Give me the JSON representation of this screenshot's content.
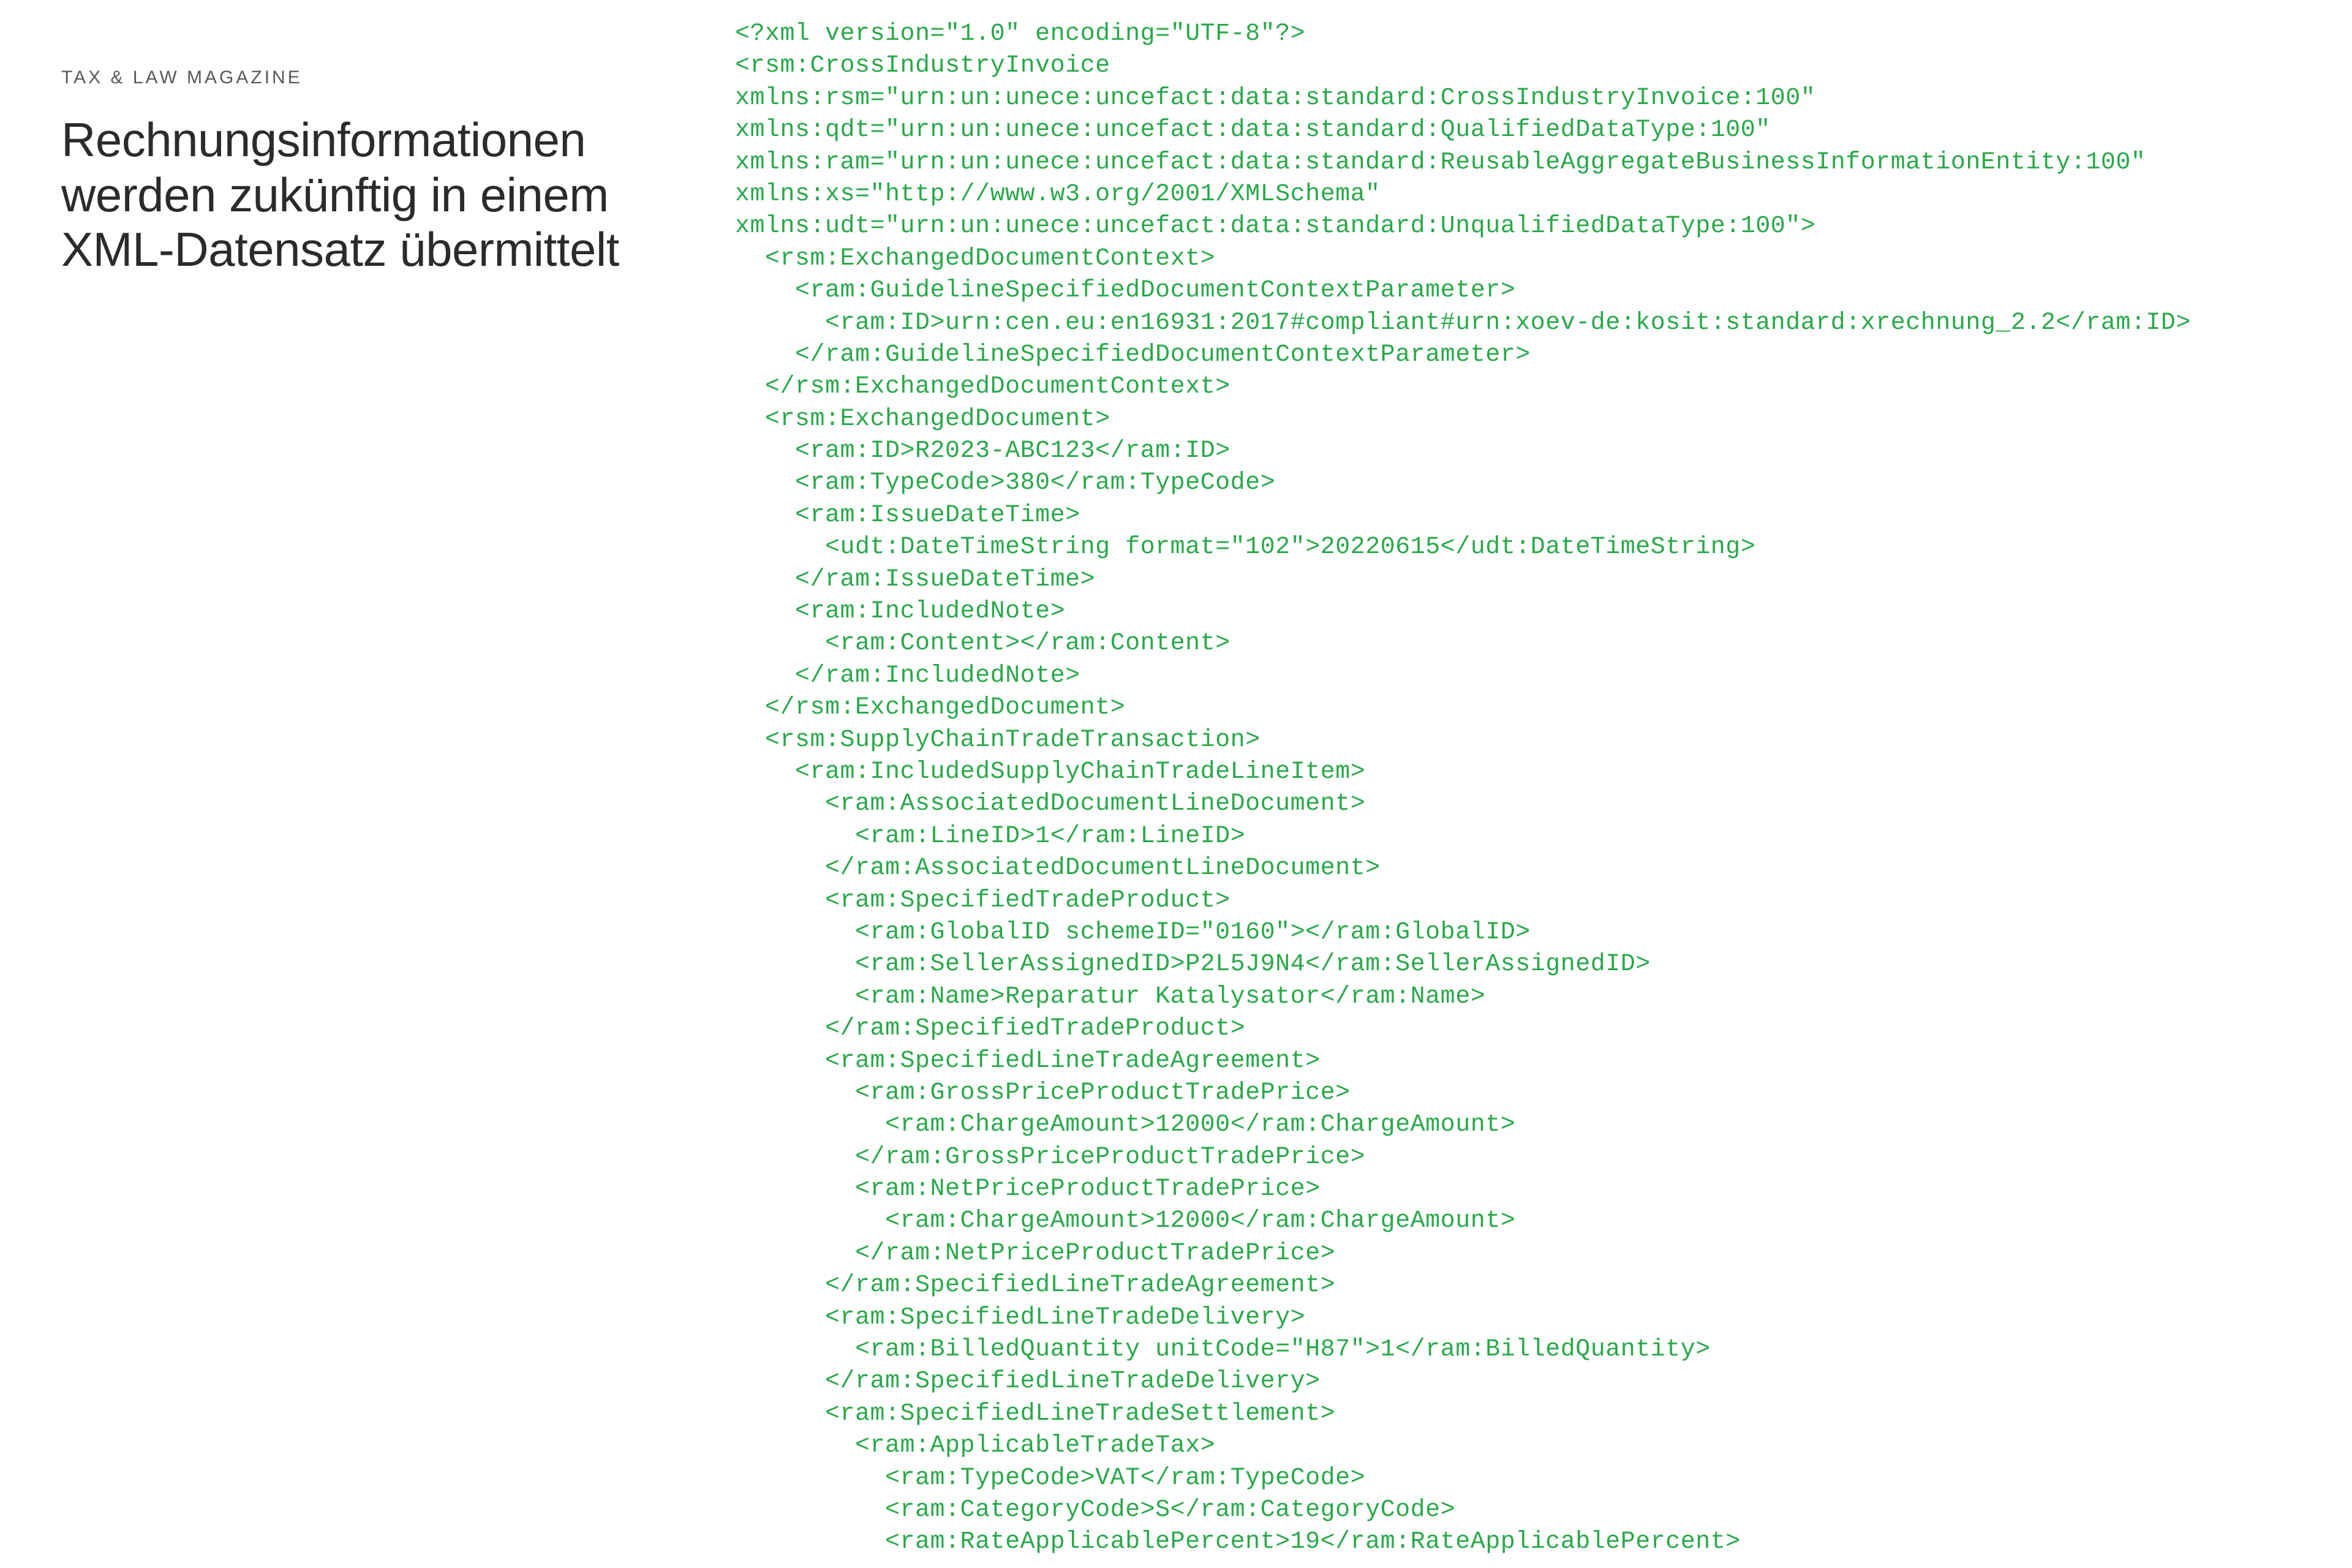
{
  "category": "TAX & LAW MAGAZINE",
  "headline": "Rechnungsinformationen werden zukünftig in einem XML-Datensatz übermittelt",
  "xml": {
    "line01": "<?xml version=\"1.0\" encoding=\"UTF-8\"?>",
    "line02": "<rsm:CrossIndustryInvoice",
    "line03": "xmlns:rsm=\"urn:un:unece:uncefact:data:standard:CrossIndustryInvoice:100\"",
    "line04": "xmlns:qdt=\"urn:un:unece:uncefact:data:standard:QualifiedDataType:100\"",
    "line05": "xmlns:ram=\"urn:un:unece:uncefact:data:standard:ReusableAggregateBusinessInformationEntity:100\"",
    "line06": "xmlns:xs=\"http://www.w3.org/2001/XMLSchema\"",
    "line07": "xmlns:udt=\"urn:un:unece:uncefact:data:standard:UnqualifiedDataType:100\">",
    "line08": "  <rsm:ExchangedDocumentContext>",
    "line09": "    <ram:GuidelineSpecifiedDocumentContextParameter>",
    "line10": "      <ram:ID>urn:cen.eu:en16931:2017#compliant#urn:xoev-de:kosit:standard:xrechnung_2.2</ram:ID>",
    "line11": "    </ram:GuidelineSpecifiedDocumentContextParameter>",
    "line12": "  </rsm:ExchangedDocumentContext>",
    "line13": "  <rsm:ExchangedDocument>",
    "line14": "    <ram:ID>R2023-ABC123</ram:ID>",
    "line15": "    <ram:TypeCode>380</ram:TypeCode>",
    "line16": "    <ram:IssueDateTime>",
    "line17": "      <udt:DateTimeString format=\"102\">20220615</udt:DateTimeString>",
    "line18": "    </ram:IssueDateTime>",
    "line19": "    <ram:IncludedNote>",
    "line20": "      <ram:Content></ram:Content>",
    "line21": "    </ram:IncludedNote>",
    "line22": "  </rsm:ExchangedDocument>",
    "line23": "  <rsm:SupplyChainTradeTransaction>",
    "line24": "    <ram:IncludedSupplyChainTradeLineItem>",
    "line25": "      <ram:AssociatedDocumentLineDocument>",
    "line26": "        <ram:LineID>1</ram:LineID>",
    "line27": "      </ram:AssociatedDocumentLineDocument>",
    "line28": "      <ram:SpecifiedTradeProduct>",
    "line29": "        <ram:GlobalID schemeID=\"0160\"></ram:GlobalID>",
    "line30": "        <ram:SellerAssignedID>P2L5J9N4</ram:SellerAssignedID>",
    "line31": "        <ram:Name>Reparatur Katalysator</ram:Name>",
    "line32": "      </ram:SpecifiedTradeProduct>",
    "line33": "      <ram:SpecifiedLineTradeAgreement>",
    "line34": "        <ram:GrossPriceProductTradePrice>",
    "line35": "          <ram:ChargeAmount>12000</ram:ChargeAmount>",
    "line36": "        </ram:GrossPriceProductTradePrice>",
    "line37": "        <ram:NetPriceProductTradePrice>",
    "line38": "          <ram:ChargeAmount>12000</ram:ChargeAmount>",
    "line39": "        </ram:NetPriceProductTradePrice>",
    "line40": "      </ram:SpecifiedLineTradeAgreement>",
    "line41": "      <ram:SpecifiedLineTradeDelivery>",
    "line42": "        <ram:BilledQuantity unitCode=\"H87\">1</ram:BilledQuantity>",
    "line43": "      </ram:SpecifiedLineTradeDelivery>",
    "line44": "      <ram:SpecifiedLineTradeSettlement>",
    "line45": "        <ram:ApplicableTradeTax>",
    "line46": "          <ram:TypeCode>VAT</ram:TypeCode>",
    "line47": "          <ram:CategoryCode>S</ram:CategoryCode>",
    "line48": "          <ram:RateApplicablePercent>19</ram:RateApplicablePercent>"
  }
}
